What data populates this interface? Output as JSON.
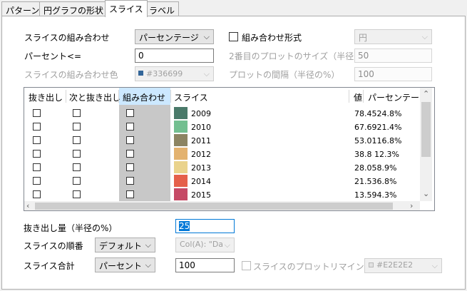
{
  "tabs": [
    {
      "label": "パターン"
    },
    {
      "label": "円グラフの形状"
    },
    {
      "label": "スライス"
    },
    {
      "label": "ラベル"
    }
  ],
  "combine": {
    "label": "スライスの組み合わせ",
    "value": "パーセンテージ",
    "format_label": "組み合わせ形式",
    "format_value": "円"
  },
  "percent": {
    "label": "パーセント<=",
    "value": "0"
  },
  "second_size": {
    "label": "2番目のプロットのサイズ（半径",
    "value": "50"
  },
  "combine_color": {
    "label": "スライスの組み合わせ色",
    "value": "#336699",
    "swatch_color": "#336699"
  },
  "plot_gap": {
    "label": "プロットの間隔（半径の%）",
    "value": "100"
  },
  "grid": {
    "headers": {
      "explode": "抜き出し",
      "next_explode": "次と抜き出し",
      "combine": "組み合わせ",
      "slice": "スライス",
      "value": "値",
      "percent": "パーセンテー"
    },
    "rows": [
      {
        "year": "2009",
        "value": "78.4524.8%",
        "color": "#4a7a6a"
      },
      {
        "year": "2010",
        "value": "67.6921.4%",
        "color": "#73bf90"
      },
      {
        "year": "2011",
        "value": "53.0116.8%",
        "color": "#8c8462"
      },
      {
        "year": "2012",
        "value": "38.8  12.3%",
        "color": "#e3b26f"
      },
      {
        "year": "2013",
        "value": "28.058.9%",
        "color": "#ead38c"
      },
      {
        "year": "2014",
        "value": "21.536.8%",
        "color": "#e5604a"
      },
      {
        "year": "2015",
        "value": "13.594.3%",
        "color": "#c64a66"
      }
    ]
  },
  "explode_amount": {
    "label": "抜き出し量（半径の%）",
    "value": "25"
  },
  "slice_order": {
    "label": "スライスの順番",
    "value": "デフォルト",
    "col_value": "Col(A): \"Da"
  },
  "slice_total": {
    "label": "スライス合計",
    "value": "パーセント",
    "total_value": "100",
    "reminder_label": "スライスのプロットリマインダー",
    "reminder_color": "#E2E2E2"
  }
}
